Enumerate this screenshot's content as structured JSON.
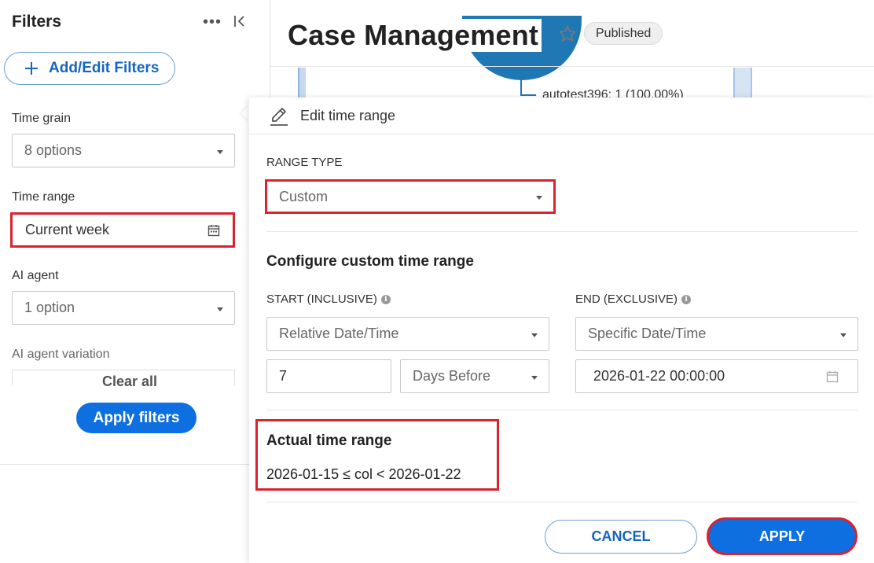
{
  "sidebar": {
    "title": "Filters",
    "more_icon": "more-horizontal-icon",
    "more_glyph": "•••",
    "collapse_icon": "collapse-left-icon",
    "add_filters_label": "Add/Edit Filters",
    "filters": [
      {
        "label": "Time grain",
        "value": "8 options"
      },
      {
        "label": "Time range",
        "value": "Current week"
      },
      {
        "label": "AI agent",
        "value": "1 option"
      },
      {
        "label": "AI agent variation",
        "value": ""
      }
    ],
    "clear_all_label": "Clear all",
    "apply_filters_label": "Apply filters"
  },
  "header": {
    "title": "Case Management",
    "star_icon": "star-outline-icon",
    "status_badge": "Published"
  },
  "chart_remnant": {
    "label": "autotest396: 1 (100.00%)",
    "color": "#1f77b4"
  },
  "popover": {
    "title": "Edit time range",
    "edit_icon": "edit-pencil-icon",
    "range_type_label": "RANGE TYPE",
    "range_type_value": "Custom",
    "configure_title": "Configure custom time range",
    "start_label": "START (INCLUSIVE)",
    "end_label": "END (EXCLUSIVE)",
    "info_glyph": "i",
    "start_mode": "Relative Date/Time",
    "start_amount": "7",
    "start_unit": "Days Before",
    "end_mode": "Specific Date/Time",
    "end_value": "2026-01-22 00:00:00",
    "actual_title": "Actual time range",
    "actual_value": "2026-01-15 ≤ col < 2026-01-22",
    "cancel_label": "CANCEL",
    "apply_label": "APPLY"
  },
  "colors": {
    "primary": "#0d6fe0",
    "link": "#1565c0",
    "highlight": "#d9232e",
    "badge_bg": "#efefef"
  }
}
